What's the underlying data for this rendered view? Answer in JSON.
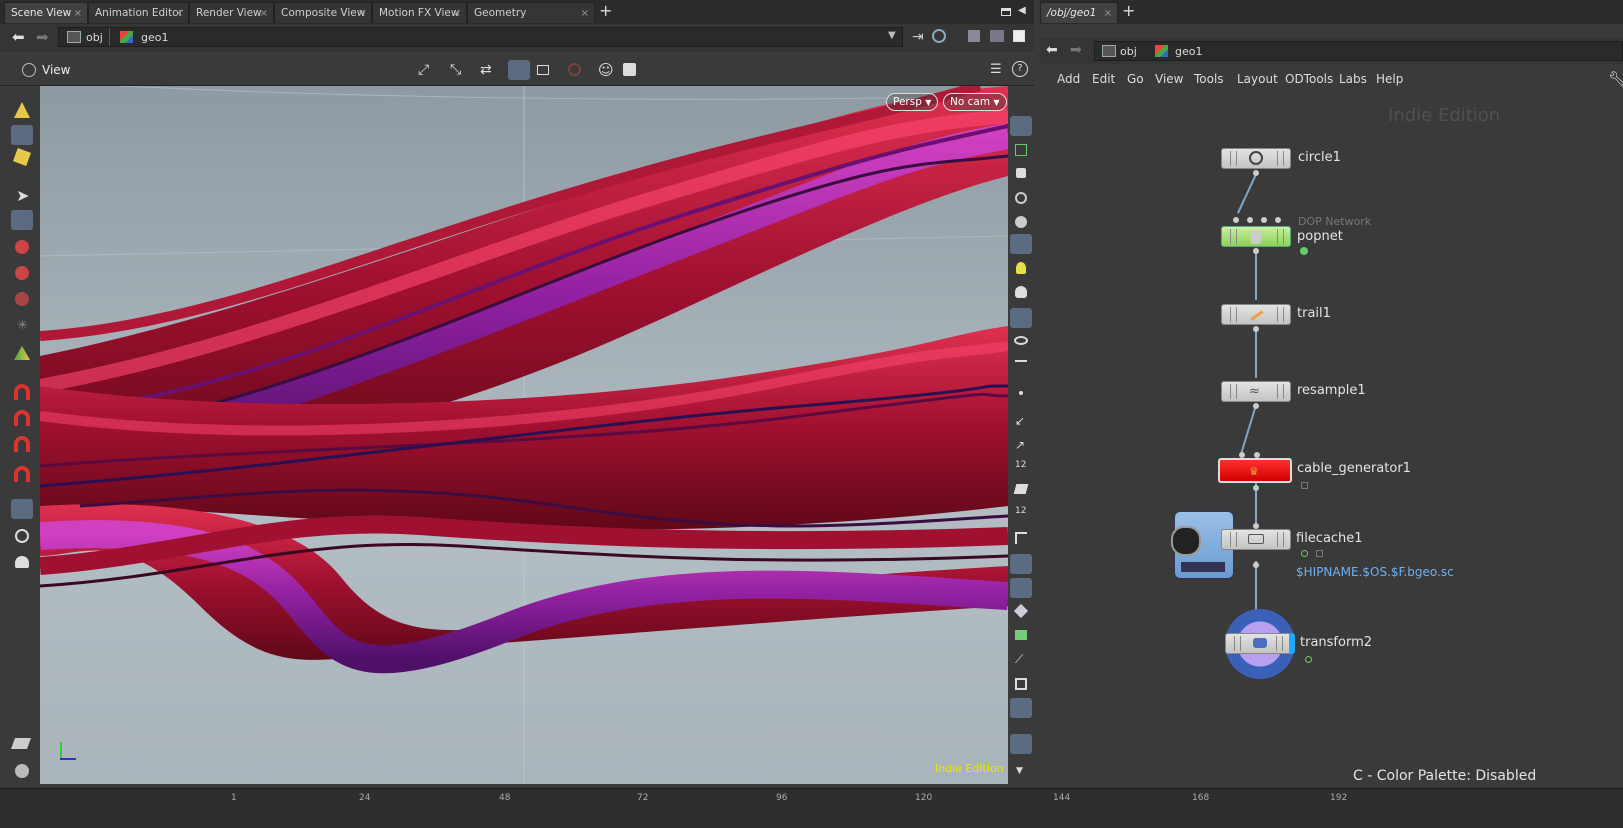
{
  "left_tabs": [
    {
      "label": "Scene View",
      "active": true
    },
    {
      "label": "Animation Editor"
    },
    {
      "label": "Render View"
    },
    {
      "label": "Composite View"
    },
    {
      "label": "Motion FX View"
    },
    {
      "label": "Geometry Spreadsheet"
    }
  ],
  "left_path": {
    "root": "obj",
    "node": "geo1"
  },
  "viewer": {
    "title": "View",
    "camera_mode": "Persp",
    "camera": "No cam",
    "watermark": "Indie Edition"
  },
  "right_tabs": [
    {
      "label": "/obj/geo1",
      "active": true
    }
  ],
  "right_path": {
    "root": "obj",
    "node": "geo1"
  },
  "menus": [
    "Add",
    "Edit",
    "Go",
    "View",
    "Tools",
    "Layout",
    "ODTools",
    "Labs",
    "Help"
  ],
  "network": {
    "watermark": "Indie Edition",
    "nodes": [
      {
        "name": "circle1",
        "type_label": ""
      },
      {
        "name": "popnet",
        "type_label": "DOP Network"
      },
      {
        "name": "trail1",
        "type_label": ""
      },
      {
        "name": "resample1",
        "type_label": ""
      },
      {
        "name": "cable_generator1",
        "type_label": ""
      },
      {
        "name": "filecache1",
        "type_label": "",
        "path": "$HIPNAME.$OS.$F.bgeo.sc"
      },
      {
        "name": "transform2",
        "type_label": ""
      }
    ],
    "status_text": "C - Color Palette: Disabled"
  },
  "timeline_ticks": [
    "1",
    "24",
    "48",
    "72",
    "96",
    "120",
    "144",
    "168",
    "192"
  ],
  "colors": {
    "selected_tool": "#5b6c82",
    "popnet_node": "#a6e07a",
    "cable_node": "#e81010",
    "wire": "#7fa6c8",
    "watermark_yellow": "#e8e800",
    "path_blue": "#6fb0f0"
  }
}
